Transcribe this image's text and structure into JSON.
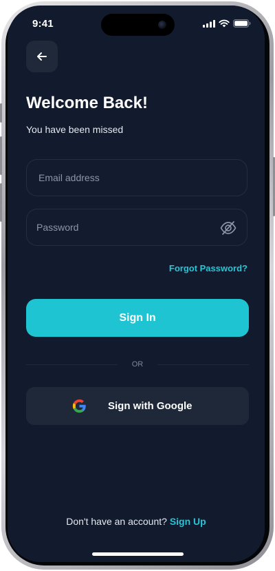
{
  "status_bar": {
    "time": "9:41",
    "signal_icon": "cellular-signal-icon",
    "wifi_icon": "wifi-icon",
    "battery_icon": "battery-icon"
  },
  "header": {
    "back_icon": "arrow-left-icon"
  },
  "main": {
    "title": "Welcome Back!",
    "subtitle": "You have been missed"
  },
  "form": {
    "email": {
      "value": "",
      "placeholder": "Email address"
    },
    "password": {
      "value": "",
      "placeholder": "Password",
      "toggle_icon": "eye-off-icon"
    },
    "forgot_label": "Forgot Password?",
    "signin_label": "Sign In"
  },
  "divider": {
    "label": "OR"
  },
  "social": {
    "google_label": "Sign with Google",
    "google_icon": "google-icon"
  },
  "footer": {
    "prompt": "Don't have an account?",
    "signup_label": "Sign Up"
  },
  "colors": {
    "background": "#121b2d",
    "surface": "#1e2839",
    "accent": "#1fc4d2",
    "link": "#27c5d6",
    "text": "#ffffff"
  }
}
